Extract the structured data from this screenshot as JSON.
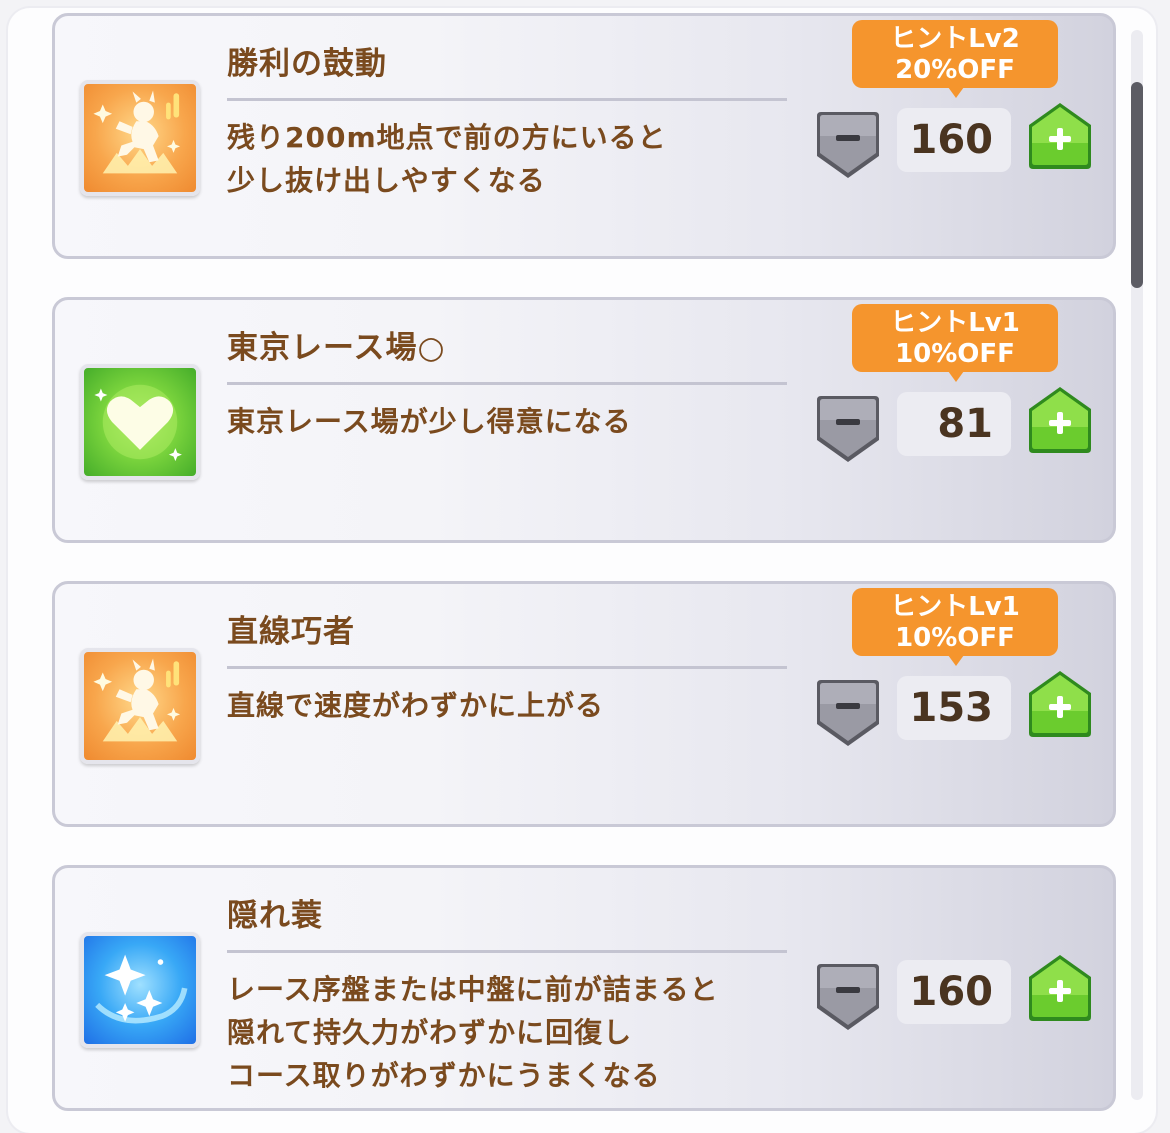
{
  "skills": [
    {
      "name": "勝利の鼓動",
      "description": [
        "残り200m地点で前の方にいると",
        "少し抜け出しやすくなる"
      ],
      "hint": {
        "level": "ヒントLv2",
        "discount": "20%OFF"
      },
      "cost": "160",
      "icon": "running-horse-icon",
      "icon_color": "#f39a3c"
    },
    {
      "name": "東京レース場○",
      "description": [
        "東京レース場が少し得意になる"
      ],
      "hint": {
        "level": "ヒントLv1",
        "discount": "10%OFF"
      },
      "cost": "81",
      "icon": "heart-icon",
      "icon_color": "#6ccf38"
    },
    {
      "name": "直線巧者",
      "description": [
        "直線で速度がわずかに上がる"
      ],
      "hint": {
        "level": "ヒントLv1",
        "discount": "10%OFF"
      },
      "cost": "153",
      "icon": "running-horse-icon",
      "icon_color": "#f39a3c"
    },
    {
      "name": "隠れ蓑",
      "description": [
        "レース序盤または中盤に前が詰まると",
        "隠れて持久力がわずかに回復し",
        "コース取りがわずかにうまくなる"
      ],
      "cost": "160",
      "icon": "sparkle-icon",
      "icon_color": "#2f8cf0"
    }
  ],
  "colors": {
    "text_brown": "#7a4a1e",
    "hint_orange": "#f5952d",
    "plus_green": "#6bcc2e",
    "minus_gray": "#8c8c96"
  }
}
